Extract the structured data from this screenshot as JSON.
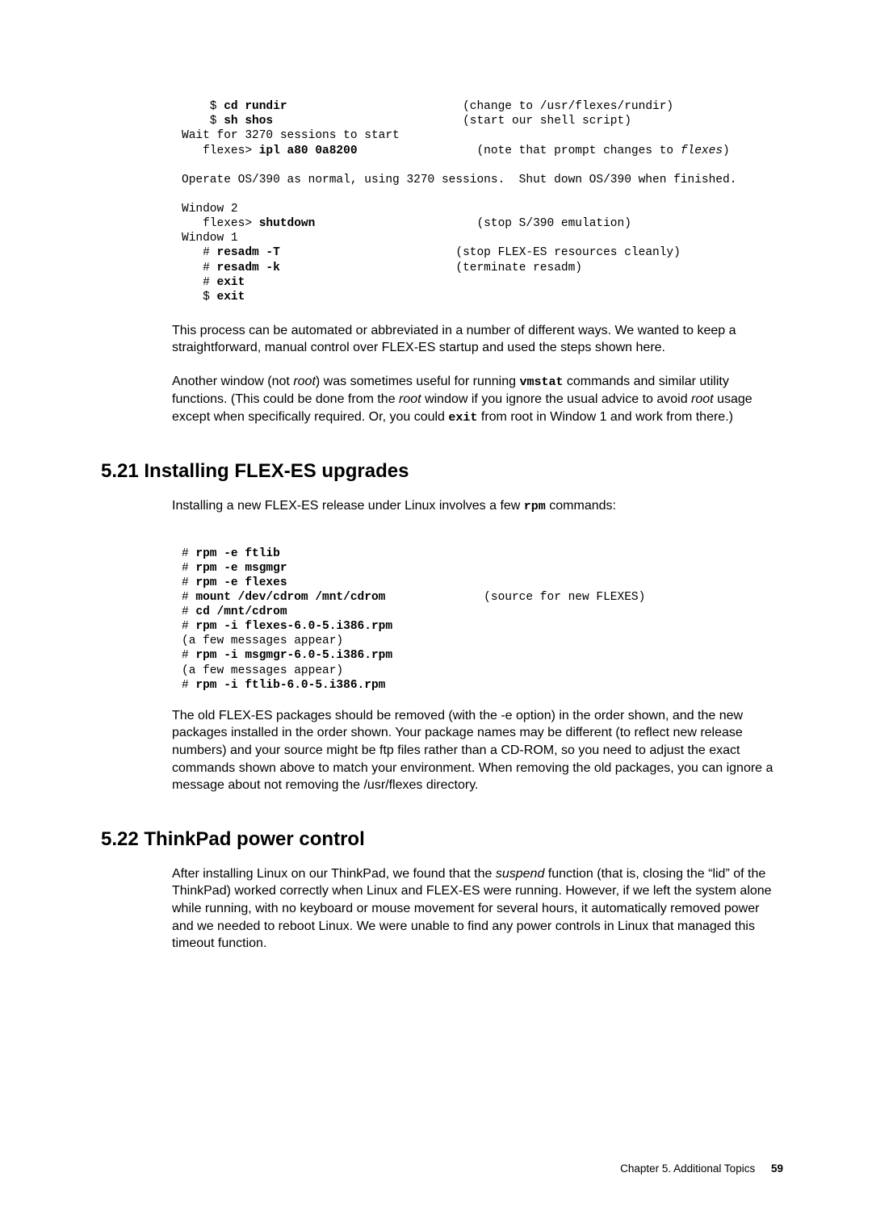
{
  "code1": {
    "l1a": "    $ ",
    "l1b": "cd rundir",
    "l1c": "                         (change to /usr/flexes/rundir)",
    "l2a": "    $ ",
    "l2b": "sh shos",
    "l2c": "                           (start our shell script)",
    "l3": "Wait for 3270 sessions to start",
    "l4a": "   flexes> ",
    "l4b": "ipl a80 0a8200",
    "l4c": "                 (note that prompt changes to ",
    "l4d": "flexes",
    "l4e": ")",
    "l5": "",
    "l6": "Operate OS/390 as normal, using 3270 sessions.  Shut down OS/390 when finished.",
    "l7": "",
    "l8": "Window 2",
    "l9a": "   flexes> ",
    "l9b": "shutdown",
    "l9c": "                       (stop S/390 emulation)",
    "l10": "Window 1",
    "l11a": "   # ",
    "l11b": "resadm -T",
    "l11c": "                         (stop FLEX-ES resources cleanly)",
    "l12a": "   # ",
    "l12b": "resadm -k",
    "l12c": "                         (terminate resadm)",
    "l13a": "   # ",
    "l13b": "exit",
    "l14a": "   $ ",
    "l14b": "exit"
  },
  "para1": {
    "t": "This process can be automated or abbreviated in a number of different ways.  We wanted to keep a straightforward, manual control over FLEX-ES startup and used the steps shown here."
  },
  "para2": {
    "a": "Another window (not ",
    "b": "root",
    "c": ") was sometimes useful for running ",
    "d": "vmstat",
    "e": " commands and similar utility functions.  (This could be done from the ",
    "f": "root",
    "g": " window if you ignore the usual advice to avoid ",
    "h": "root",
    "i": " usage except when specifically required.  Or, you could ",
    "j": "exit",
    "k": " from root in Window 1 and work from there.)"
  },
  "sec521": {
    "title": "5.21  Installing FLEX-ES upgrades",
    "intro_a": "Installing a new FLEX-ES release under Linux involves a few ",
    "intro_b": "rpm",
    "intro_c": " commands:"
  },
  "code2": {
    "l1a": "# ",
    "l1b": "rpm -e ftlib",
    "l2a": "# ",
    "l2b": "rpm -e msgmgr",
    "l3a": "# ",
    "l3b": "rpm -e flexes",
    "l4a": "# ",
    "l4b": "mount /dev/cdrom /mnt/cdrom",
    "l4c": "              (source for new FLEXES)",
    "l5a": "# ",
    "l5b": "cd /mnt/cdrom",
    "l6a": "# ",
    "l6b": "rpm -i flexes-6.0-5.i386.rpm",
    "l7": "(a few messages appear)",
    "l8a": "# ",
    "l8b": "rpm -i msgmgr-6.0-5.i386.rpm",
    "l9": "(a few messages appear)",
    "l10a": "# ",
    "l10b": "rpm -i ftlib-6.0-5.i386.rpm"
  },
  "para3": {
    "t": "The old FLEX-ES packages should be removed (with the -e option) in the order shown, and the new packages installed in the order shown.  Your package names may be different (to reflect new release numbers) and your source might be ftp files rather than a CD-ROM, so you need to adjust the exact commands shown above to match your environment.  When removing the old packages, you can ignore a message about not removing the /usr/flexes directory."
  },
  "sec522": {
    "title": "5.22  ThinkPad power control"
  },
  "para4": {
    "a": "After installing Linux on our ThinkPad, we found that the ",
    "b": "suspend",
    "c": " function (that is, closing the “lid” of the ThinkPad) worked correctly when Linux and FLEX-ES were running.  However, if we left the system alone while running, with no keyboard or mouse movement for several hours, it automatically removed power and we needed to reboot Linux.  We were unable to find any power controls in Linux that managed this timeout function."
  },
  "footer": {
    "chapter": "Chapter 5. Additional Topics",
    "page": "59"
  }
}
